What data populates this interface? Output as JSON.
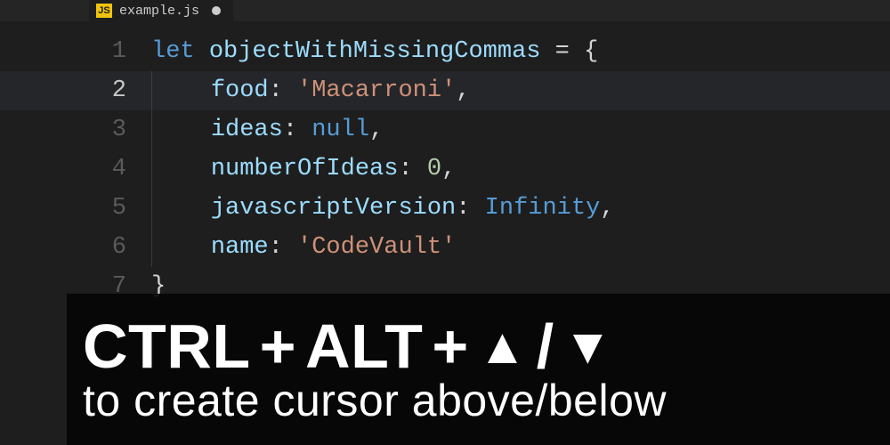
{
  "tab": {
    "badge": "JS",
    "filename": "example.js",
    "dirty": true
  },
  "code": {
    "lines": [
      {
        "num": "1",
        "active": false
      },
      {
        "num": "2",
        "active": true
      },
      {
        "num": "3",
        "active": false
      },
      {
        "num": "4",
        "active": false
      },
      {
        "num": "5",
        "active": false
      },
      {
        "num": "6",
        "active": false
      },
      {
        "num": "7",
        "active": false
      }
    ],
    "tokens": {
      "let": "let",
      "var_name": "objectWithMissingCommas",
      "eq": " = ",
      "lbrace": "{",
      "rbrace": "}",
      "indent": "    ",
      "k_food": "food",
      "v_food": "'Macarroni'",
      "k_ideas": "ideas",
      "v_ideas": "null",
      "k_numberOfIdeas": "numberOfIdeas",
      "v_numberOfIdeas": "0",
      "k_javascriptVersion": "javascriptVersion",
      "v_javascriptVersion": "Infinity",
      "k_name": "name",
      "v_name": "'CodeVault'",
      "colon": ": ",
      "comma": ","
    }
  },
  "caption": {
    "keys_ctrl": "CTRL",
    "keys_plus": " + ",
    "keys_alt": "ALT",
    "arrow_up": "▲",
    "slash": "/",
    "arrow_down": "▼",
    "line2": "to create cursor above/below"
  }
}
